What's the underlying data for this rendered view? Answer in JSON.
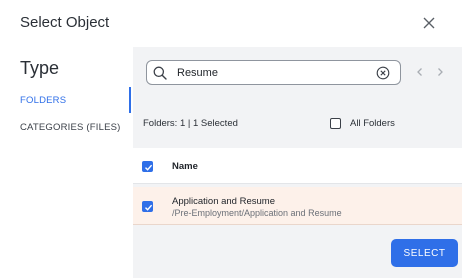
{
  "dialog": {
    "title": "Select Object"
  },
  "sidebar": {
    "title": "Type",
    "items": [
      {
        "label": "FOLDERS",
        "active": true
      },
      {
        "label": "CATEGORIES (FILES)",
        "active": false
      }
    ]
  },
  "search": {
    "value": "Resume",
    "placeholder": ""
  },
  "summary": {
    "text": "Folders: 1 | 1 Selected"
  },
  "filter": {
    "all_folders_label": "All Folders",
    "all_folders_checked": false
  },
  "table": {
    "header_checked": true,
    "columns": [
      "Name"
    ],
    "rows": [
      {
        "title": "Application and Resume",
        "path": "/Pre-Employment/Application and Resume",
        "checked": true
      }
    ]
  },
  "footer": {
    "select_label": "SELECT"
  },
  "icons": {
    "close": "close-icon",
    "search": "search-icon",
    "clear": "clear-circle-icon",
    "prev": "chevron-left-icon",
    "next": "chevron-right-icon",
    "check": "checkmark-icon"
  },
  "colors": {
    "accent": "#2f6fe8",
    "panel_bg": "#f2f3f5",
    "selected_row_bg": "#fdf1ea",
    "text": "#1f2329",
    "muted_text": "#6b7078"
  }
}
